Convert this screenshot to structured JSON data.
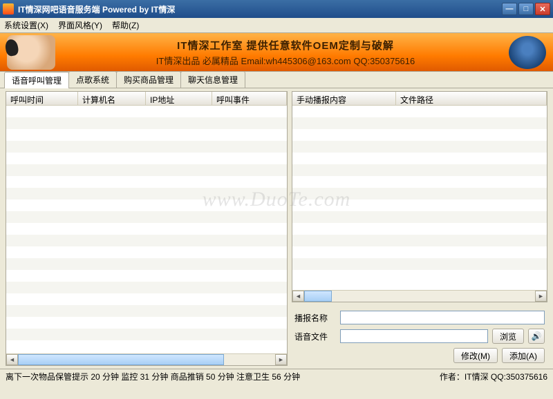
{
  "window": {
    "title": "IT情深网吧语音服务端  Powered by IT情深"
  },
  "menu": {
    "system": "系统设置(X)",
    "style": "界面风格(Y)",
    "help": "帮助(Z)"
  },
  "banner": {
    "line1": "IT情深工作室 提供任意软件OEM定制与破解",
    "line2": "IT情深出品  必属精品  Email:wh445306@163.com  QQ:350375616"
  },
  "tabs": [
    "语音呼叫管理",
    "点歌系统",
    "购买商品管理",
    "聊天信息管理"
  ],
  "activeTab": 0,
  "leftCols": {
    "time": "呼叫时间",
    "host": "计算机名",
    "ip": "IP地址",
    "event": "呼叫事件"
  },
  "rightCols": {
    "content": "手动播报内容",
    "path": "文件路径"
  },
  "form": {
    "nameLabel": "播报名称",
    "fileLabel": "语音文件",
    "browse": "浏览",
    "modify": "修改(M)",
    "add": "添加(A)",
    "nameValue": "",
    "fileValue": ""
  },
  "status": {
    "left": "离下一次物品保管提示 20 分钟 监控 31 分钟 商品推销 50 分钟 注意卫生 56 分钟",
    "right": "作者：IT情深 QQ:350375616"
  },
  "watermark": "www.DuoTe.com"
}
